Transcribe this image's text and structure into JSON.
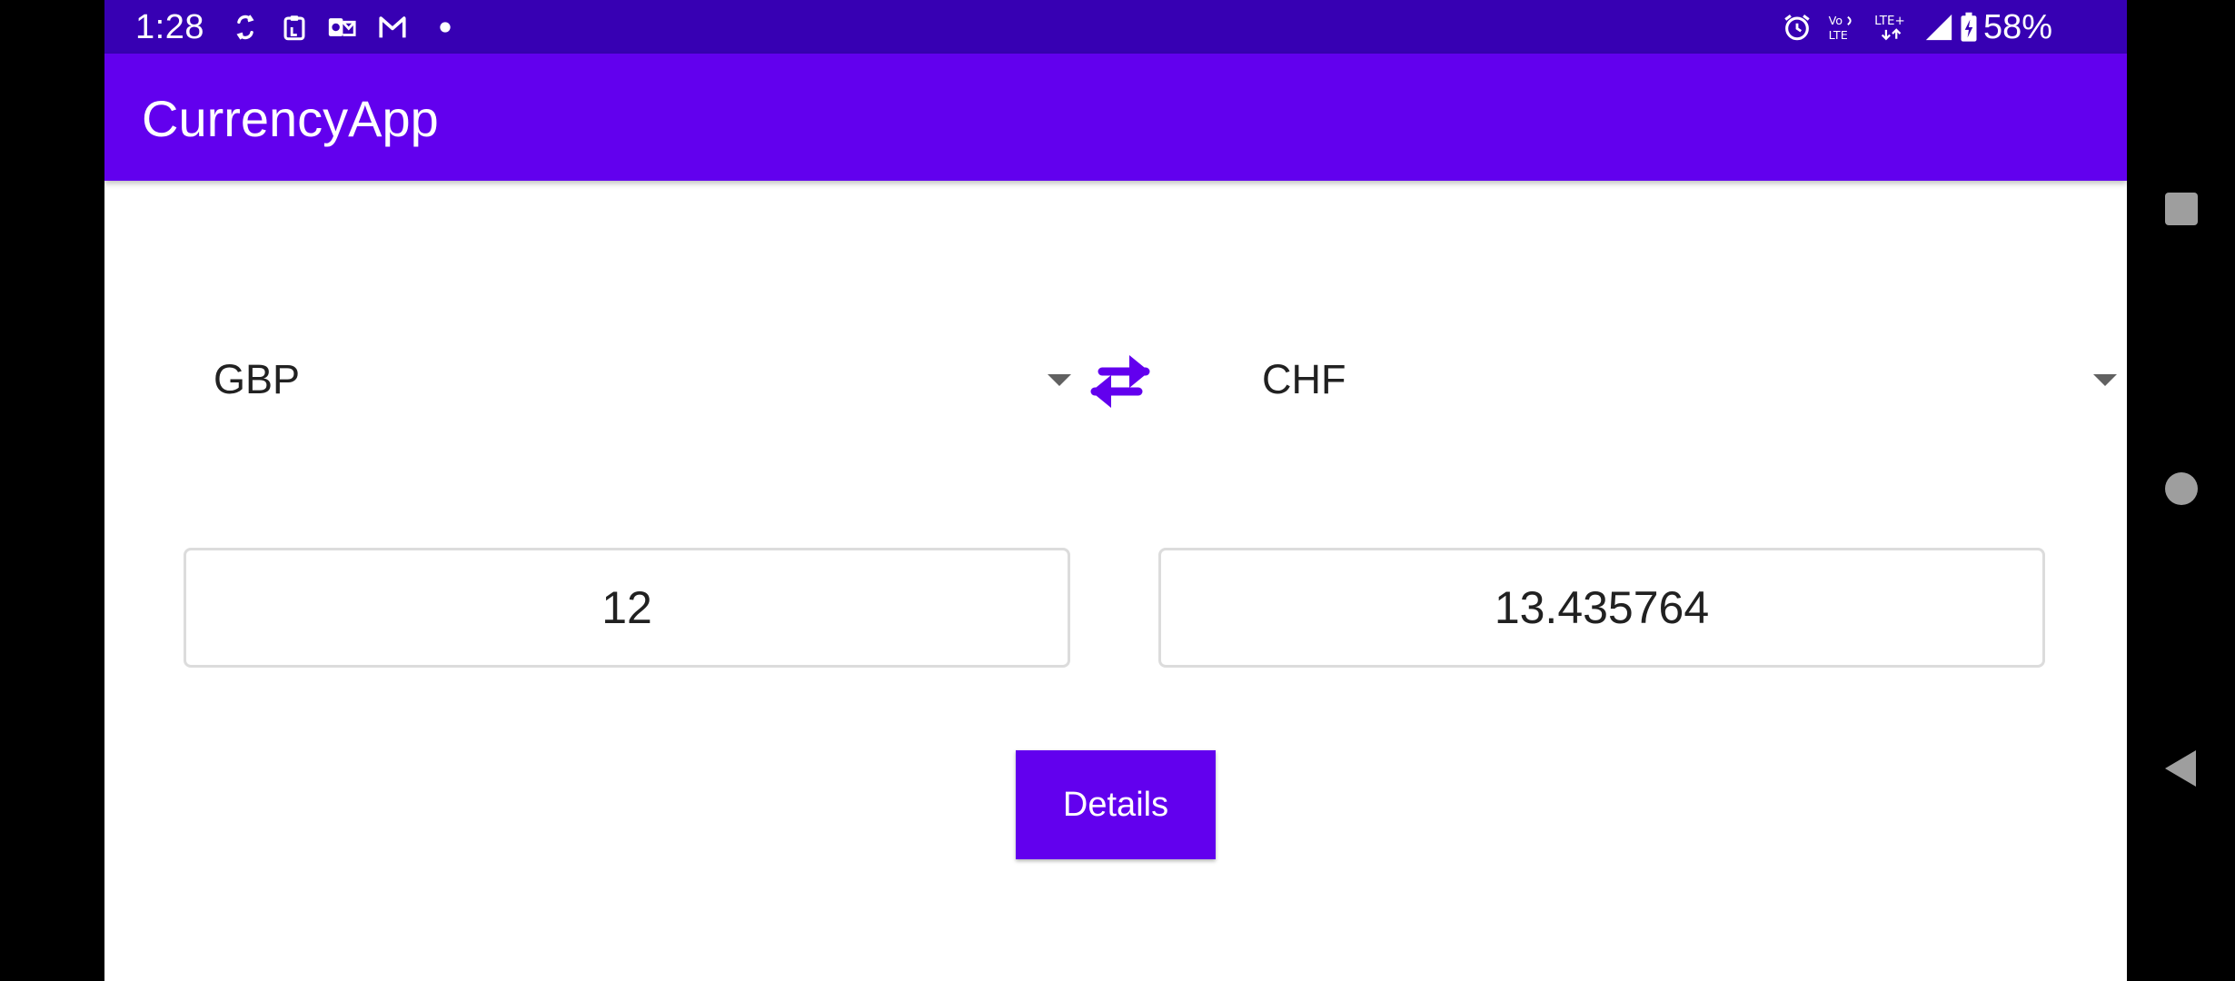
{
  "status_bar": {
    "time": "1:28",
    "battery_percent": "58%",
    "left_icons": [
      "sync-icon",
      "clipboard-icon",
      "outlook-icon",
      "gmail-icon",
      "dot-icon"
    ],
    "right_icons": [
      "alarm-icon",
      "volte-icon",
      "lte-plus-icon",
      "signal-icon",
      "battery-charging-icon"
    ]
  },
  "app_bar": {
    "title": "CurrencyApp"
  },
  "converter": {
    "from_currency": "GBP",
    "to_currency": "CHF",
    "from_amount": "12",
    "to_amount": "13.435764",
    "details_label": "Details"
  },
  "colors": {
    "status_bar": "#3700b3",
    "primary": "#6200ee",
    "accent": "#6200ee"
  },
  "nav_bar": {
    "buttons": [
      "recents-icon",
      "home-icon",
      "back-icon"
    ]
  }
}
